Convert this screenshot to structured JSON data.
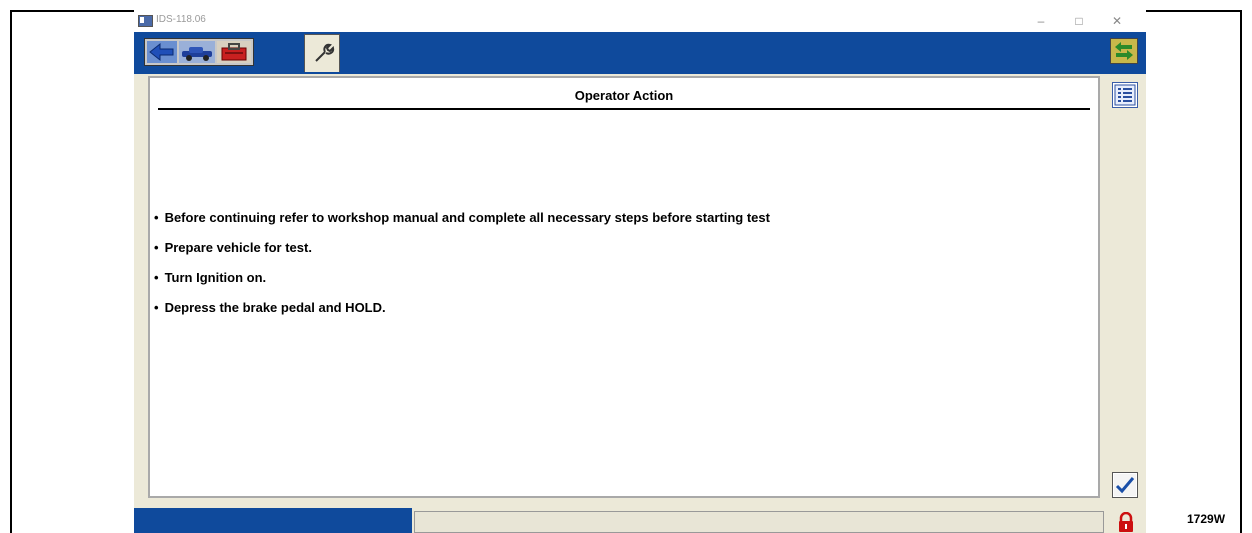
{
  "window": {
    "title": "IDS-118.06",
    "controls": {
      "minimize": "–",
      "restore": "□",
      "close": "✕"
    }
  },
  "toolbar": {
    "buttons": [
      "back-arrow-icon",
      "vehicle-icon",
      "toolbox-icon"
    ],
    "active_tab": "wrench-icon",
    "side_button": "swap-arrows-icon"
  },
  "panel": {
    "title": "Operator Action",
    "steps": [
      "Before continuing refer to workshop manual and complete all necessary steps before starting test",
      "Prepare vehicle for test.",
      "Turn Ignition on.",
      "Depress the brake pedal and HOLD."
    ]
  },
  "side": {
    "list_button": "list-icon",
    "confirm_button": "checkmark-icon"
  },
  "status": {
    "lock_icon": "padlock-icon"
  },
  "figure_code": "1729W",
  "colors": {
    "toolbar_blue": "#0f4a9c",
    "panel_bg": "#ece9d8",
    "lock_red": "#cc1010",
    "check_blue": "#1a4fa8"
  }
}
